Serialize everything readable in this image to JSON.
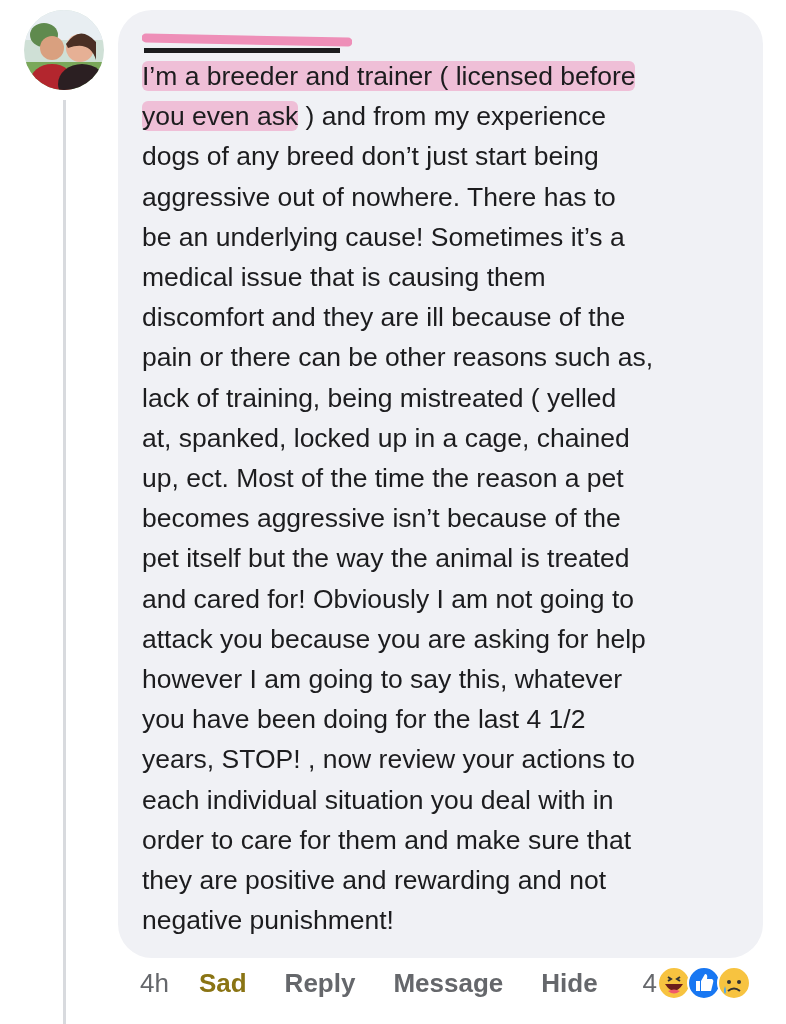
{
  "comment": {
    "author_redacted": true,
    "lines": [
      [
        {
          "text": "I’m a breeder and trainer ( licensed before",
          "highlighted": true
        }
      ],
      [
        {
          "text": "you even ask",
          "highlighted": true
        },
        {
          "text": " ) and from my experience",
          "highlighted": false
        }
      ],
      [
        {
          "text": "dogs of any breed don’t just start being",
          "highlighted": false
        }
      ],
      [
        {
          "text": "aggressive out of nowhere. There has to",
          "highlighted": false
        }
      ],
      [
        {
          "text": "be an underlying cause! Sometimes it’s a",
          "highlighted": false
        }
      ],
      [
        {
          "text": "medical issue that is causing them",
          "highlighted": false
        }
      ],
      [
        {
          "text": "discomfort and they are ill because of the",
          "highlighted": false
        }
      ],
      [
        {
          "text": "pain or there can be other reasons such as,",
          "highlighted": false
        }
      ],
      [
        {
          "text": "lack of training, being mistreated ( yelled",
          "highlighted": false
        }
      ],
      [
        {
          "text": "at, spanked, locked up in a cage, chained",
          "highlighted": false
        }
      ],
      [
        {
          "text": "up, ect. Most of the time the reason a pet",
          "highlighted": false
        }
      ],
      [
        {
          "text": "becomes aggressive isn’t because of the",
          "highlighted": false
        }
      ],
      [
        {
          "text": "pet itself but the way the animal is treated",
          "highlighted": false
        }
      ],
      [
        {
          "text": "and cared for! Obviously I am not going to",
          "highlighted": false
        }
      ],
      [
        {
          "text": "attack you because you are asking for help",
          "highlighted": false
        }
      ],
      [
        {
          "text": "however I am going to say this, whatever",
          "highlighted": false
        }
      ],
      [
        {
          "text": "you have been doing for the last 4 1/2",
          "highlighted": false
        }
      ],
      [
        {
          "text": "years, STOP! , now review your actions to",
          "highlighted": false
        }
      ],
      [
        {
          "text": "each individual situation you deal with in",
          "highlighted": false
        }
      ],
      [
        {
          "text": "order to care for them and make sure that",
          "highlighted": false
        }
      ],
      [
        {
          "text": "they are positive and rewarding and not",
          "highlighted": false
        }
      ],
      [
        {
          "text": "negative punishment!",
          "highlighted": false
        }
      ]
    ],
    "time": "4h",
    "actions": [
      {
        "label": "Sad",
        "selected": true
      },
      {
        "label": "Reply",
        "selected": false
      },
      {
        "label": "Message",
        "selected": false
      },
      {
        "label": "Hide",
        "selected": false
      }
    ],
    "reaction_count": "4"
  }
}
